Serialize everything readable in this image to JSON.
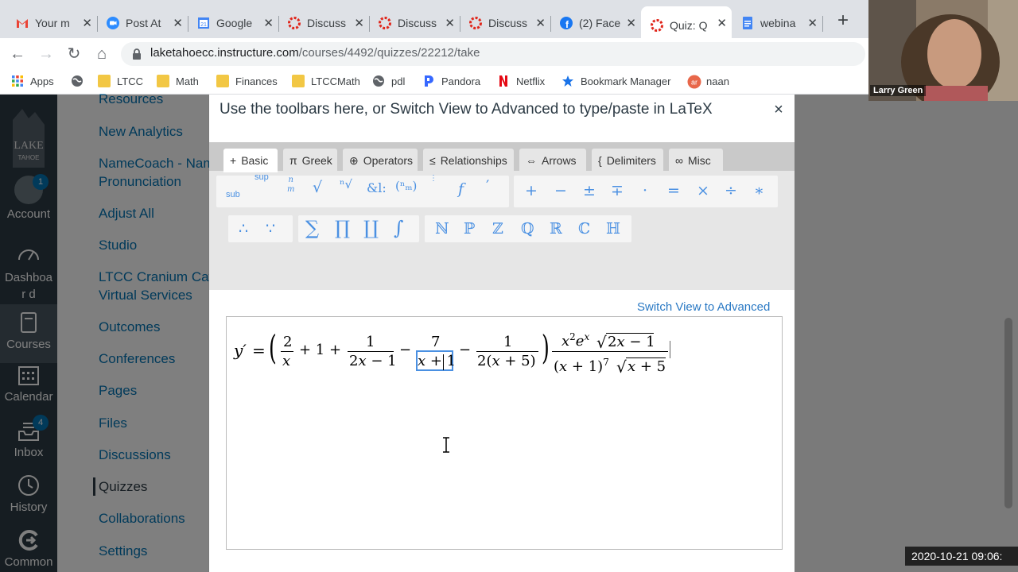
{
  "browser": {
    "tabs": [
      {
        "label": "Your m",
        "icon": "gmail-icon"
      },
      {
        "label": "Post At",
        "icon": "zoom-icon"
      },
      {
        "label": "Google",
        "icon": "calendar-icon"
      },
      {
        "label": "Discuss",
        "icon": "canvas-icon"
      },
      {
        "label": "Discuss",
        "icon": "canvas-icon"
      },
      {
        "label": "Discuss",
        "icon": "canvas-icon"
      },
      {
        "label": "(2) Face",
        "icon": "facebook-icon"
      },
      {
        "label": "Quiz: Q",
        "icon": "canvas-icon",
        "active": true
      },
      {
        "label": "webina",
        "icon": "docs-icon"
      }
    ],
    "url_host": "laketahoecc.instructure.com",
    "url_path": "/courses/4492/quizzes/22212/take",
    "bookmarks": [
      {
        "label": "Apps",
        "icon": "apps-grid-icon"
      },
      {
        "label": "",
        "icon": "globe-icon"
      },
      {
        "label": "LTCC",
        "icon": "folder-icon"
      },
      {
        "label": "Math",
        "icon": "folder-icon"
      },
      {
        "label": "Finances",
        "icon": "folder-icon"
      },
      {
        "label": "LTCCMath",
        "icon": "folder-icon"
      },
      {
        "label": "pdl",
        "icon": "globe-icon"
      },
      {
        "label": "Pandora",
        "icon": "pandora-icon"
      },
      {
        "label": "Netflix",
        "icon": "netflix-icon"
      },
      {
        "label": "Bookmark Manager",
        "icon": "star-icon"
      },
      {
        "label": "naan",
        "icon": "naan-icon"
      }
    ]
  },
  "global_nav": {
    "account": "Account",
    "account_badge": "1",
    "dashboard": "Dashboar d",
    "courses": "Courses",
    "calendar": "Calendar",
    "inbox": "Inbox",
    "inbox_badge": "4",
    "history": "History",
    "commons": "Common"
  },
  "course_nav": [
    "Resources",
    "New Analytics",
    "NameCoach - Nam",
    "Pronunciation",
    "Adjust All",
    "Studio",
    "LTCC Cranium Caf",
    "Virtual Services",
    "Outcomes",
    "Conferences",
    "Pages",
    "Files",
    "Discussions",
    "Quizzes",
    "Collaborations",
    "Settings"
  ],
  "modal": {
    "title": "Use the toolbars here, or Switch View to Advanced to type/paste in LaTeX",
    "tabs": [
      {
        "label": "Basic",
        "icon": "+"
      },
      {
        "label": "Greek",
        "icon": "π"
      },
      {
        "label": "Operators",
        "icon": "⊕"
      },
      {
        "label": "Relationships",
        "icon": "≤"
      },
      {
        "label": "Arrows",
        "icon": "⇔"
      },
      {
        "label": "Delimiters",
        "icon": "{"
      },
      {
        "label": "Misc",
        "icon": "∞"
      }
    ],
    "switch_view": "Switch View to Advanced"
  },
  "video": {
    "name": "Larry Green"
  },
  "timestamp": "2020-10-21 09:06:"
}
